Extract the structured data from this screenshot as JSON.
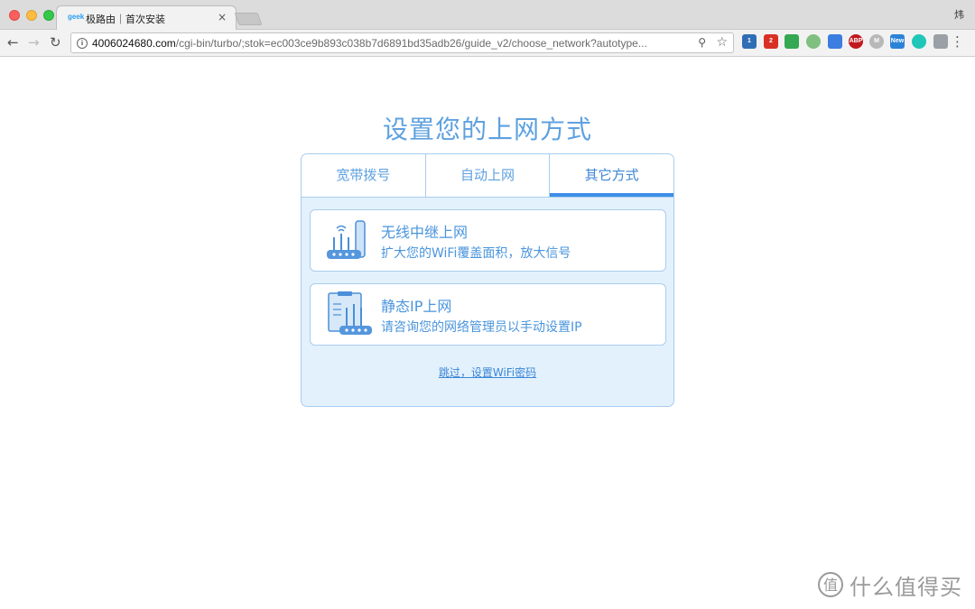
{
  "browser": {
    "tab_favicon": "geek",
    "tab_title": "极路由｜首次安装",
    "tab_close": "×",
    "profile_name": "炜",
    "url_host": "4006024680.com",
    "url_path": "/cgi-bin/turbo/;stok=ec003ce9b893c038b7d6891bd35adb26/guide_v2/choose_network?autotype...",
    "extensions": [
      {
        "name": "extension-blue-icon",
        "text": "1",
        "color": "#2f6eb5"
      },
      {
        "name": "gmail-icon",
        "text": "2",
        "color": "#d93025"
      },
      {
        "name": "google-drive-icon",
        "text": "",
        "color": "#34a853"
      },
      {
        "name": "circle-ext-icon",
        "text": "",
        "color": "#7fbf7f"
      },
      {
        "name": "blue-square-ext-icon",
        "text": "",
        "color": "#3b7de0"
      },
      {
        "name": "adblock-icon",
        "text": "ABP",
        "color": "#c0181e"
      },
      {
        "name": "m-ext-icon",
        "text": "M",
        "color": "#b8b8b8"
      },
      {
        "name": "new-ext-icon",
        "text": "New",
        "color": "#2b83d8"
      },
      {
        "name": "teal-ext-icon",
        "text": "",
        "color": "#1ec7b8"
      },
      {
        "name": "bird-ext-icon",
        "text": "",
        "color": "#9aa0a6"
      }
    ]
  },
  "page": {
    "title": "设置您的上网方式",
    "tabs": [
      {
        "label": "宽带拨号",
        "active": false
      },
      {
        "label": "自动上网",
        "active": false
      },
      {
        "label": "其它方式",
        "active": true
      }
    ],
    "options": [
      {
        "title": "无线中继上网",
        "desc": "扩大您的WiFi覆盖面积，放大信号"
      },
      {
        "title": "静态IP上网",
        "desc": "请咨询您的网络管理员以手动设置IP"
      }
    ],
    "skip_link": "跳过，设置WiFi密码"
  },
  "watermark": {
    "text": "什么值得买"
  },
  "colors": {
    "accent": "#5ea1df",
    "active_tab_bar": "#3d8ee8",
    "panel_bg": "#e3f1fd",
    "panel_border": "#a9cdee"
  }
}
